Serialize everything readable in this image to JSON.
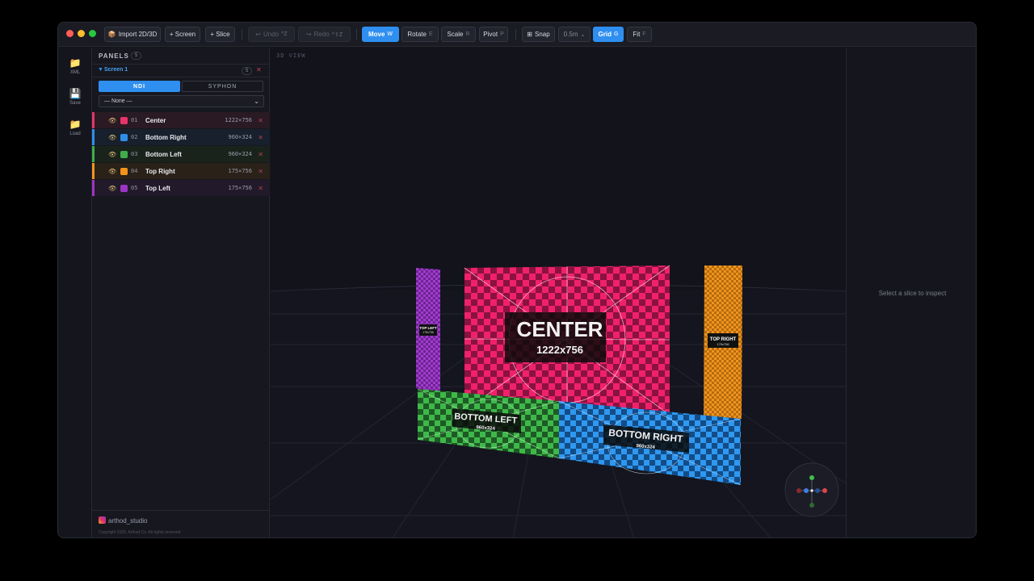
{
  "toolbar": {
    "import": "Import 2D/3D",
    "screen": "+ Screen",
    "slice": "+ Slice",
    "undo": "Undo",
    "undo_key": "^Z",
    "redo": "Redo",
    "redo_key": "^⇧Z",
    "move": "Move",
    "move_key": "W",
    "rotate": "Rotate",
    "rotate_key": "E",
    "scale": "Scale",
    "scale_key": "R",
    "pivot": "Pivot",
    "pivot_key": "P",
    "snap": "Snap",
    "snap_value": "0.5m",
    "grid": "Grid",
    "grid_key": "G",
    "fit": "Fit",
    "fit_key": "F"
  },
  "rail": [
    {
      "label": "XML",
      "icon": "folder-icon"
    },
    {
      "label": "Save",
      "icon": "floppy-icon"
    },
    {
      "label": "Load",
      "icon": "folder-icon"
    }
  ],
  "panels": {
    "title": "PANELS",
    "count": "5",
    "screen_name": "Screen 1",
    "screen_count": "5",
    "seg_ndi": "NDI",
    "seg_syphon": "SYPHON",
    "source_select": "— None —",
    "items": [
      {
        "num": "01",
        "name": "Center",
        "dim": "1222×756",
        "color": "#e8336b"
      },
      {
        "num": "02",
        "name": "Bottom Right",
        "dim": "960×324",
        "color": "#2f8fe8"
      },
      {
        "num": "03",
        "name": "Bottom Left",
        "dim": "960×324",
        "color": "#3fae4a"
      },
      {
        "num": "04",
        "name": "Top Right",
        "dim": "175×756",
        "color": "#f2941c"
      },
      {
        "num": "05",
        "name": "Top Left",
        "dim": "175×756",
        "color": "#9b35c4"
      }
    ]
  },
  "viewport": {
    "label": "3D VIEW",
    "center_title": "CENTER",
    "center_dim": "1222x756",
    "bl_title": "BOTTOM LEFT",
    "bl_dim": "960x324",
    "br_title": "BOTTOM RIGHT",
    "br_dim": "960x324",
    "tl_title": "TOP LEFT",
    "tl_dim": "175x756",
    "tr_title": "TOP RIGHT",
    "tr_dim": "175x756"
  },
  "inspector": {
    "empty": "Select a slice to inspect"
  },
  "footer": {
    "handle": "arthod_studio",
    "copyright": "Copyright 2026, Arthod Co. All rights reserved"
  }
}
